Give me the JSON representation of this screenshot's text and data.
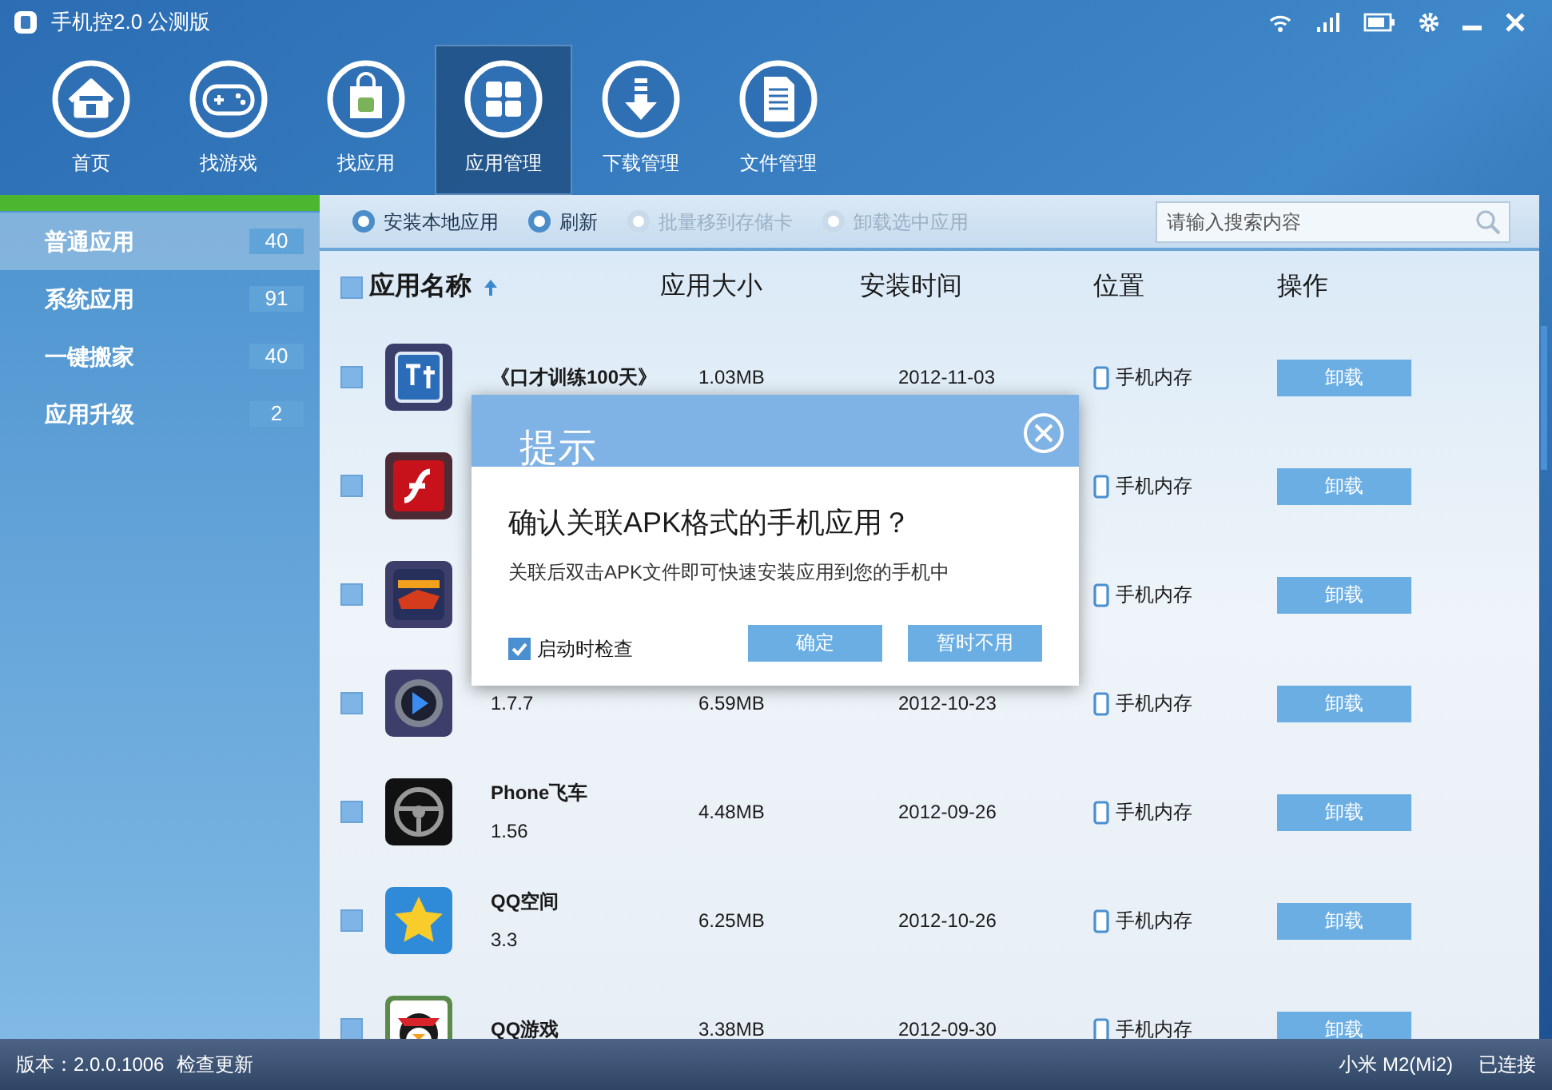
{
  "window": {
    "title": "手机控2.0 公测版"
  },
  "nav": [
    {
      "label": "首页",
      "kind": "home",
      "selected": false
    },
    {
      "label": "找游戏",
      "kind": "game",
      "selected": false
    },
    {
      "label": "找应用",
      "kind": "bag",
      "selected": false
    },
    {
      "label": "应用管理",
      "kind": "grid",
      "selected": true
    },
    {
      "label": "下载管理",
      "kind": "download",
      "selected": false
    },
    {
      "label": "文件管理",
      "kind": "file",
      "selected": false
    }
  ],
  "sidebar": {
    "items": [
      {
        "label": "普通应用",
        "count": "40",
        "selected": true
      },
      {
        "label": "系统应用",
        "count": "91",
        "selected": false
      },
      {
        "label": "一键搬家",
        "count": "40",
        "selected": false
      },
      {
        "label": "应用升级",
        "count": "2",
        "selected": false
      }
    ]
  },
  "toolbar": {
    "actions": [
      {
        "label": "安装本地应用",
        "disabled": false
      },
      {
        "label": "刷新",
        "disabled": false
      },
      {
        "label": "批量移到存储卡",
        "disabled": true
      },
      {
        "label": "卸载选中应用",
        "disabled": true
      }
    ],
    "search": {
      "placeholder": "请输入搜索内容"
    }
  },
  "table": {
    "select_all": {
      "checked": false
    },
    "columns": [
      {
        "label": "应用名称",
        "sorted": true
      },
      {
        "label": "应用大小",
        "sorted": false
      },
      {
        "label": "安装时间",
        "sorted": false
      },
      {
        "label": "位置",
        "sorted": false
      },
      {
        "label": "操作",
        "sorted": false
      }
    ],
    "rows": [
      {
        "checked": false,
        "name": "《口才训练100天》",
        "size": "1.03MB",
        "date": "2012-11-03",
        "location": "手机内存",
        "action": "卸载"
      },
      {
        "checked": false,
        "location": "手机内存",
        "action": "卸载"
      },
      {
        "checked": false,
        "location": "手机内存",
        "action": "卸载"
      },
      {
        "checked": false,
        "version": "1.7.7",
        "size": "6.59MB",
        "date": "2012-10-23",
        "location": "手机内存",
        "action": "卸载"
      },
      {
        "checked": false,
        "name": "Phone飞车",
        "version": "1.56",
        "size": "4.48MB",
        "date": "2012-09-26",
        "location": "手机内存",
        "action": "卸载"
      },
      {
        "checked": false,
        "name": "QQ空间",
        "version": "3.3",
        "size": "6.25MB",
        "date": "2012-10-26",
        "location": "手机内存",
        "action": "卸载"
      },
      {
        "checked": false,
        "name": "QQ游戏",
        "size": "3.38MB",
        "date": "2012-09-30",
        "location": "手机内存",
        "action": "卸载"
      }
    ]
  },
  "dialog": {
    "title": "提示",
    "heading": "确认关联APK格式的手机应用？",
    "message": "关联后双击APK文件即可快速安装应用到您的手机中",
    "checkbox": {
      "label": "启动时检查",
      "checked": true
    },
    "buttons": [
      "确定",
      "暂时不用"
    ]
  },
  "status_bar": {
    "version": "版本：2.0.0.1006",
    "update_link": "检查更新",
    "device": "小米 M2(Mi2)",
    "connection": "已连接"
  }
}
